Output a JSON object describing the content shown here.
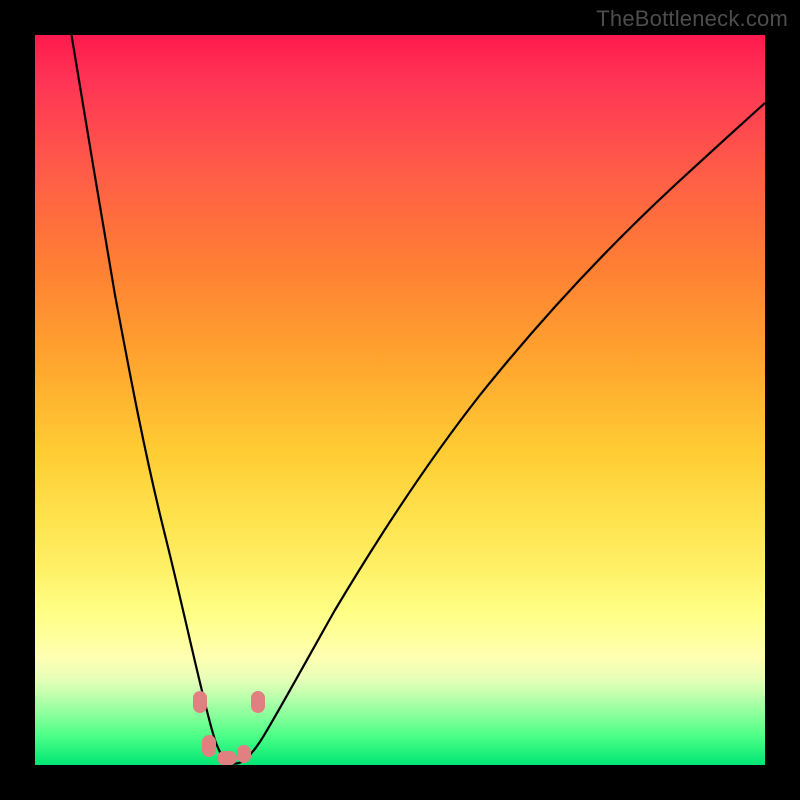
{
  "watermark": "TheBottleneck.com",
  "chart_data": {
    "type": "line",
    "title": "",
    "xlabel": "",
    "ylabel": "",
    "xlim": [
      0,
      100
    ],
    "ylim": [
      0,
      100
    ],
    "grid": false,
    "legend": false,
    "series": [
      {
        "name": "curve",
        "x": [
          5,
          8,
          11,
          14,
          17,
          19,
          21,
          23,
          24,
          25,
          26,
          27,
          28,
          29,
          30,
          32,
          36,
          42,
          50,
          60,
          72,
          86,
          100
        ],
        "values": [
          100,
          82,
          64,
          46,
          30,
          20,
          12,
          6,
          3,
          1,
          0,
          0,
          0,
          1,
          2,
          5,
          12,
          22,
          35,
          49,
          62,
          75,
          86
        ]
      }
    ],
    "markers": [
      {
        "x": 22.5,
        "y": 8
      },
      {
        "x": 23.5,
        "y": 2
      },
      {
        "x": 26.0,
        "y": 0.5
      },
      {
        "x": 28.5,
        "y": 1.5
      },
      {
        "x": 30.5,
        "y": 8
      }
    ],
    "background_gradient": {
      "top": "#ff1a4d",
      "mid": "#ffe24d",
      "bottom": "#00e673"
    },
    "curve_color": "#000000",
    "marker_color": "#e08080"
  }
}
